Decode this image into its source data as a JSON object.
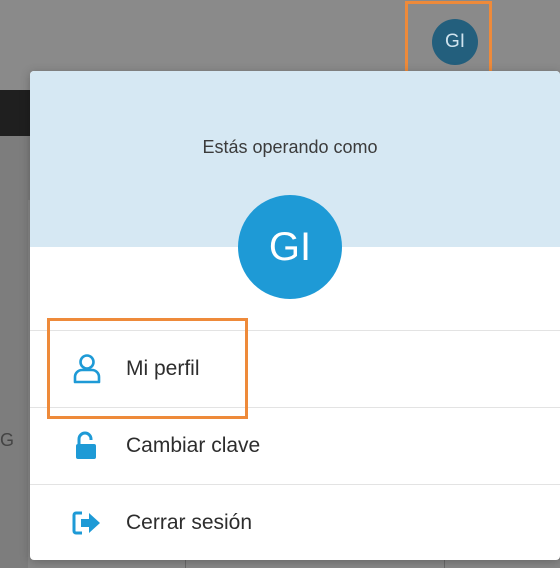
{
  "topbar": {
    "avatar_initials": "GI"
  },
  "user_menu": {
    "caption": "Estás operando como",
    "avatar_initials": "GI",
    "items": [
      {
        "label": "Mi perfil",
        "icon": "user-icon"
      },
      {
        "label": "Cambiar clave",
        "icon": "unlock-icon"
      },
      {
        "label": "Cerrar sesión",
        "icon": "logout-icon"
      }
    ]
  },
  "colors": {
    "accent": "#1e9ad6",
    "header_bg": "#d6e8f3",
    "highlight": "#ee8a3a",
    "top_avatar_bg": "#235f7d"
  }
}
